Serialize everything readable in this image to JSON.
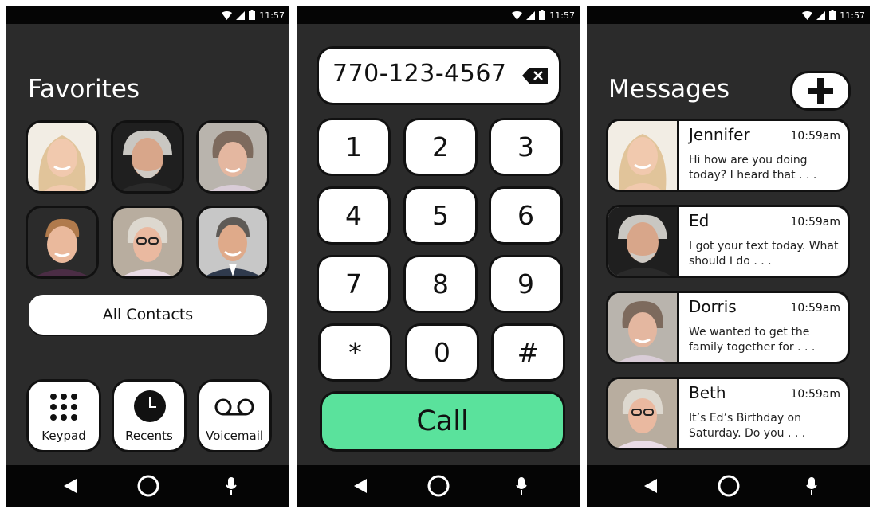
{
  "status_time": "11:57",
  "favorites": {
    "title": "Favorites",
    "all_contacts_label": "All Contacts",
    "tools": [
      {
        "label": "Keypad",
        "icon": "keypad-icon"
      },
      {
        "label": "Recents",
        "icon": "clock-icon"
      },
      {
        "label": "Voicemail",
        "icon": "voicemail-icon"
      }
    ]
  },
  "dialer": {
    "number": "770-123-4567",
    "keys": [
      "1",
      "2",
      "3",
      "4",
      "5",
      "6",
      "7",
      "8",
      "9",
      "*",
      "0",
      "#"
    ],
    "call_label": "Call",
    "call_color": "#5ae29c"
  },
  "messages": {
    "title": "Messages",
    "items": [
      {
        "name": "Jennifer",
        "time": "10:59am",
        "preview": "Hi how are you doing today? I heard that . . ."
      },
      {
        "name": "Ed",
        "time": "10:59am",
        "preview": "I got your text today. What should I do . . ."
      },
      {
        "name": "Dorris",
        "time": "10:59am",
        "preview": "We wanted to get the family together for . . ."
      },
      {
        "name": "Beth",
        "time": "10:59am",
        "preview": "It’s Ed’s Birthday on Saturday. Do you . . ."
      }
    ]
  },
  "nav": {
    "icons": [
      "back-icon",
      "home-icon",
      "mic-icon"
    ]
  }
}
